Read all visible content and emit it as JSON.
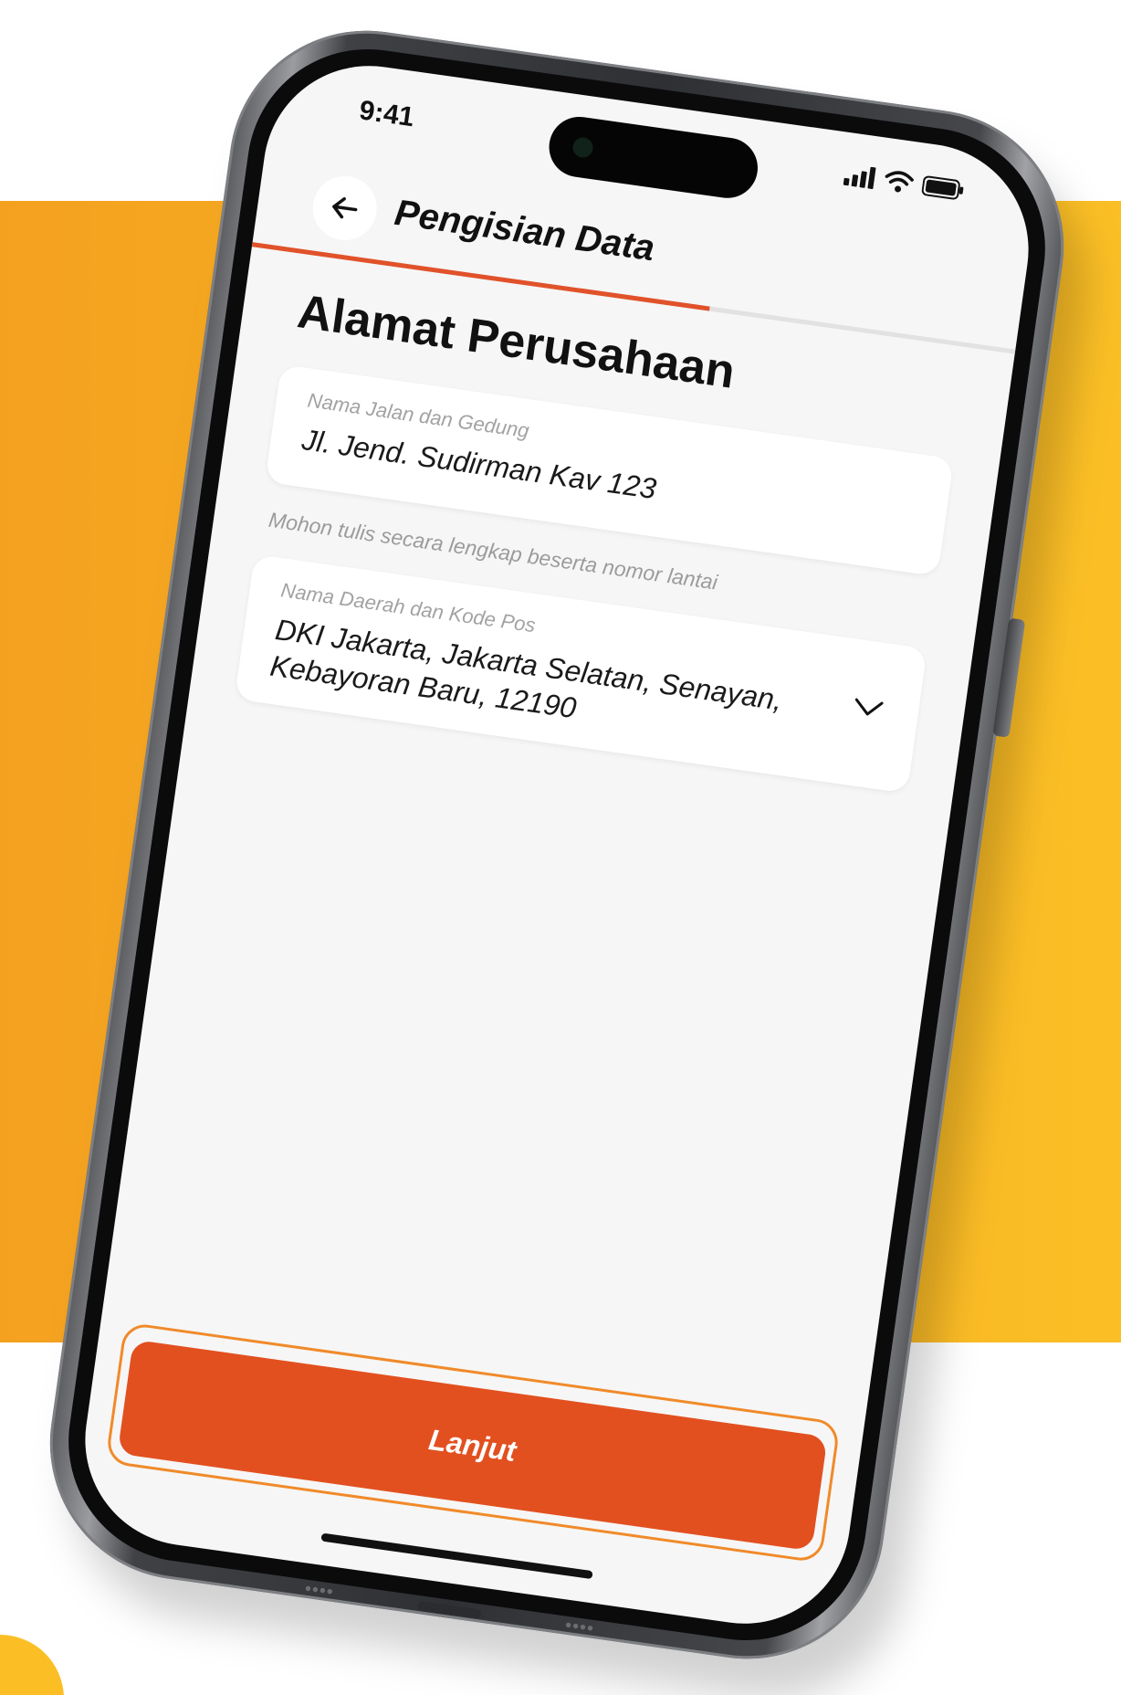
{
  "status_bar": {
    "time": "9:41",
    "icons": [
      "signal-icon",
      "wifi-icon",
      "battery-icon"
    ]
  },
  "header": {
    "back_icon": "arrow-left-icon",
    "title": "Pengisian Data"
  },
  "progress": {
    "fraction": 0.6,
    "color": "#e1522a"
  },
  "section": {
    "title": "Alamat Perusahaan"
  },
  "street_field": {
    "label": "Nama Jalan dan Gedung",
    "value": "Jl. Jend. Sudirman Kav 123",
    "helper": "Mohon tulis secara lengkap beserta nomor lantai"
  },
  "region_field": {
    "label": "Nama Daerah dan Kode Pos",
    "value": "DKI Jakarta, Jakarta Selatan, Senayan, Kebayoran Baru, 12190",
    "icon": "chevron-down-icon"
  },
  "footer": {
    "cta_label": "Lanjut"
  },
  "colors": {
    "background_accent": "#f8b324",
    "primary": "#e2501f"
  }
}
